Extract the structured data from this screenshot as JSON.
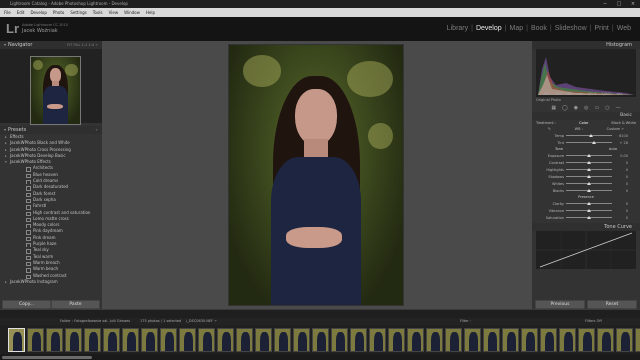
{
  "titlebar": {
    "title": "Lightroom Catalog - Adobe Photoshop Lightroom - Develop"
  },
  "window_controls": [
    "−",
    "□",
    "×"
  ],
  "menu": [
    "File",
    "Edit",
    "Develop",
    "Photo",
    "Settings",
    "Tools",
    "View",
    "Window",
    "Help"
  ],
  "identity": {
    "logo": "Lr",
    "product": "Adobe Lightroom CC 2015",
    "user": "Jacek Woźniak"
  },
  "modules": [
    "Library",
    "Develop",
    "Map",
    "Book",
    "Slideshow",
    "Print",
    "Web"
  ],
  "active_module": "Develop",
  "navigator": {
    "title": "Navigator",
    "options": "FIT   FILL   1:1   1:4 ÷"
  },
  "presets": {
    "title": "Presets",
    "folders": [
      "Effects",
      "JacekWPhoto Black and White",
      "JacekWPhoto Cross Processing",
      "JacekWPhoto Develop Basic",
      "JacekWPhoto Effects"
    ],
    "items": [
      "Architects",
      "Blue heaven",
      "Cold dreams",
      "Dark desaturated",
      "Dark forest",
      "Dark sepha",
      "Fahrstl",
      "High contrast and saturation",
      "Lomo matte cross",
      "Moody colors",
      "Pink daydream",
      "Pink dream",
      "Purple haze",
      "Teal sky",
      "Teal warm",
      "Warm breach",
      "Warm beach",
      "Washed contrast"
    ],
    "last_folder": "JacekWPhoto Instagram"
  },
  "left_buttons": {
    "copy": "Copy...",
    "paste": "Paste"
  },
  "histogram": {
    "title": "Histogram",
    "values": "ISO 100    85 mm    f/1.4    1/500 sec",
    "original": "Original Photo"
  },
  "basic": {
    "title": "Basic",
    "treatment": [
      "Treatment :",
      "Color",
      "Black & White"
    ],
    "wb": [
      "WB :",
      "Custom ÷"
    ],
    "sliders_wb": [
      {
        "label": "Temp",
        "val": "6100",
        "pos": 0.55
      },
      {
        "label": "Tint",
        "val": "+ 26",
        "pos": 0.6
      }
    ],
    "tone_header": [
      "Tone",
      "Auto"
    ],
    "sliders_tone": [
      {
        "label": "Exposure",
        "val": "0.00",
        "pos": 0.5
      },
      {
        "label": "Contrast",
        "val": "0",
        "pos": 0.5
      },
      {
        "label": "Highlights",
        "val": "0",
        "pos": 0.5
      },
      {
        "label": "Shadows",
        "val": "0",
        "pos": 0.5
      },
      {
        "label": "Whites",
        "val": "0",
        "pos": 0.5
      },
      {
        "label": "Blacks",
        "val": "0",
        "pos": 0.5
      }
    ],
    "presence_header": "Presence",
    "sliders_presence": [
      {
        "label": "Clarity",
        "val": "0",
        "pos": 0.5
      },
      {
        "label": "Vibrance",
        "val": "0",
        "pos": 0.5
      },
      {
        "label": "Saturation",
        "val": "0",
        "pos": 0.5
      }
    ]
  },
  "tone_curve": {
    "title": "Tone Curve"
  },
  "right_buttons": {
    "previous": "Previous",
    "reset": "Reset"
  },
  "filmstrip_info": {
    "path": "Folder : Fotografowanie sal. Julii Gimaes",
    "count": "175 photos / 1 selected",
    "file": "/_DSC0630.NEF ÷",
    "filter": "Filter :",
    "filters_off": "Filters Off"
  },
  "filmstrip": {
    "count": 34,
    "selected": 0
  }
}
